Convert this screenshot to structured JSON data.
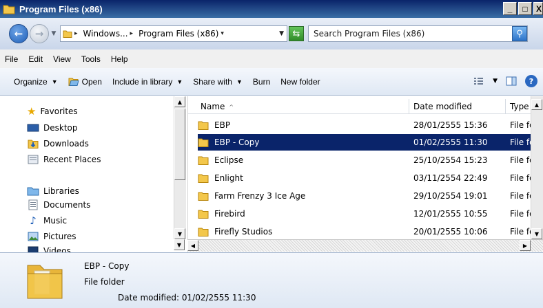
{
  "window": {
    "title": "Program Files (x86)",
    "buttons": {
      "minimize": "_",
      "maximize": "□",
      "close": "X"
    }
  },
  "address": {
    "crumbs": [
      "Windows...",
      "Program Files (x86)"
    ],
    "search_placeholder": "Search Program Files (x86)"
  },
  "menu": [
    "File",
    "Edit",
    "View",
    "Tools",
    "Help"
  ],
  "commands": {
    "organize": "Organize",
    "open": "Open",
    "include_in_library": "Include in library",
    "share_with": "Share with",
    "burn": "Burn",
    "new_folder": "New folder"
  },
  "navigation": {
    "favorites": {
      "label": "Favorites",
      "items": [
        "Desktop",
        "Downloads",
        "Recent Places"
      ]
    },
    "libraries": {
      "label": "Libraries",
      "items": [
        "Documents",
        "Music",
        "Pictures",
        "Videos"
      ]
    }
  },
  "columns": {
    "name": "Name",
    "date_modified": "Date modified",
    "type": "Type"
  },
  "files": [
    {
      "name": "EBP",
      "date": "28/01/2555 15:36",
      "type": "File fo",
      "selected": false
    },
    {
      "name": "EBP - Copy",
      "date": "01/02/2555 11:30",
      "type": "File fo",
      "selected": true
    },
    {
      "name": "Eclipse",
      "date": "25/10/2554 15:23",
      "type": "File fo",
      "selected": false
    },
    {
      "name": "Enlight",
      "date": "03/11/2554 22:49",
      "type": "File fo",
      "selected": false
    },
    {
      "name": "Farm Frenzy 3 Ice Age",
      "date": "29/10/2554 19:01",
      "type": "File fo",
      "selected": false
    },
    {
      "name": "Firebird",
      "date": "12/01/2555 10:55",
      "type": "File fo",
      "selected": false
    },
    {
      "name": "Firefly Studios",
      "date": "20/01/2555 10:06",
      "type": "File fo",
      "selected": false
    }
  ],
  "details": {
    "name": "EBP - Copy",
    "type": "File folder",
    "date_modified": "Date modified: 01/02/2555 11:30"
  },
  "colors": {
    "selection": "#0a246a",
    "titlebar_start": "#0a246a",
    "titlebar_end": "#3a6ea5",
    "folder": "#e8b53a"
  }
}
